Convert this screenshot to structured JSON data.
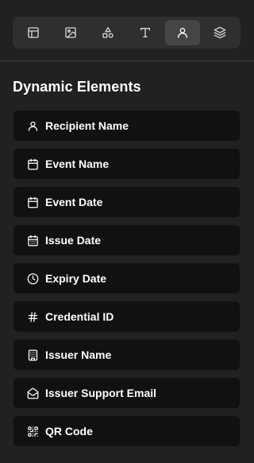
{
  "toolbar": {
    "tools": [
      {
        "icon": "layout-icon",
        "active": false
      },
      {
        "icon": "image-icon",
        "active": false
      },
      {
        "icon": "shapes-icon",
        "active": false
      },
      {
        "icon": "text-icon",
        "active": false
      },
      {
        "icon": "user-icon",
        "active": true
      },
      {
        "icon": "layers-icon",
        "active": false
      }
    ]
  },
  "section": {
    "title": "Dynamic Elements"
  },
  "elements": [
    {
      "label": "Recipient Name",
      "icon": "user-icon"
    },
    {
      "label": "Event Name",
      "icon": "calendar-icon"
    },
    {
      "label": "Event Date",
      "icon": "calendar-icon"
    },
    {
      "label": "Issue Date",
      "icon": "calendar-days-icon"
    },
    {
      "label": "Expiry Date",
      "icon": "clock-icon"
    },
    {
      "label": "Credential ID",
      "icon": "hash-icon"
    },
    {
      "label": "Issuer Name",
      "icon": "building-icon"
    },
    {
      "label": "Issuer Support Email",
      "icon": "mail-open-icon"
    },
    {
      "label": "QR Code",
      "icon": "qr-code-icon"
    }
  ]
}
